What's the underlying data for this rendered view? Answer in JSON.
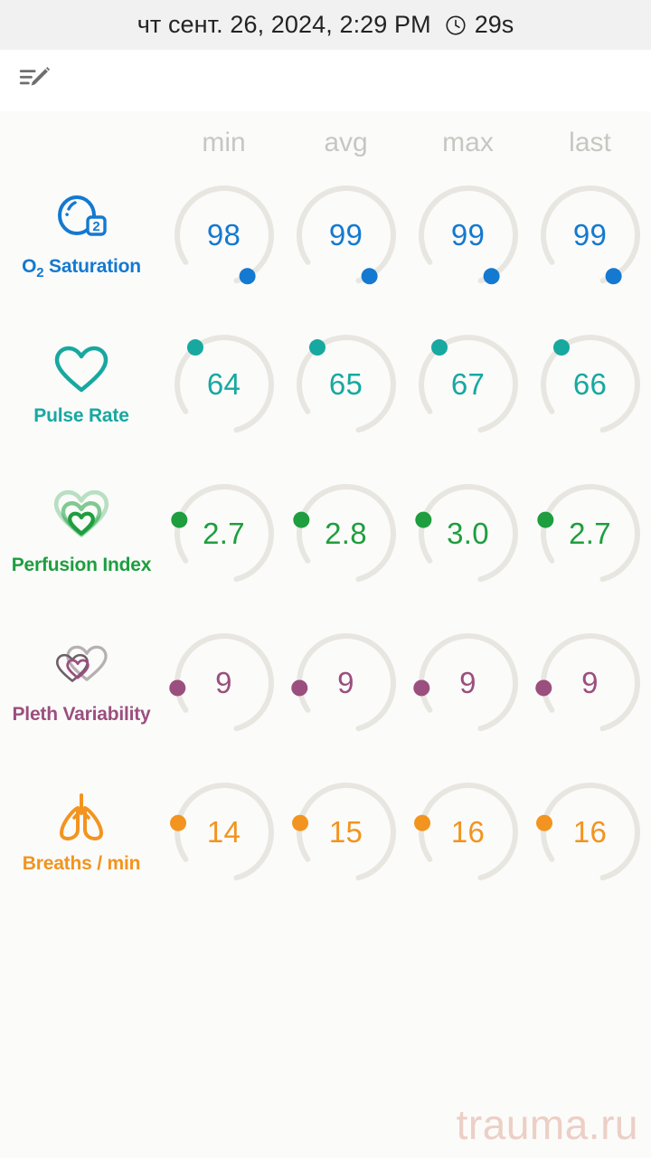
{
  "titlebar": {
    "datetime": "чт сент. 26, 2024, 2:29 PM",
    "clock_icon": "clock-icon",
    "elapsed": "29s"
  },
  "toolbar": {
    "edit_note_icon": "edit-note-icon"
  },
  "columns": [
    "min",
    "avg",
    "max",
    "last"
  ],
  "metrics": [
    {
      "name": "O₂ Saturation",
      "name_main": "O",
      "name_sub": "2",
      "name_rest": " Saturation",
      "icon": "oxygen-bubble-icon",
      "color": "#1479d0",
      "values": [
        "98",
        "99",
        "99",
        "99"
      ],
      "dot_positions": [
        0.95,
        0.95,
        0.95,
        0.95
      ]
    },
    {
      "name": "Pulse Rate",
      "icon": "heart-outline-icon",
      "color": "#17a8a0",
      "values": [
        "64",
        "65",
        "67",
        "66"
      ],
      "dot_positions": [
        0.3,
        0.3,
        0.3,
        0.3
      ]
    },
    {
      "name": "Perfusion Index",
      "icon": "nested-hearts-icon",
      "color": "#1e9e3e",
      "values": [
        "2.7",
        "2.8",
        "3.0",
        "2.7"
      ],
      "dot_positions": [
        0.18,
        0.18,
        0.18,
        0.18
      ]
    },
    {
      "name": "Pleth Variability",
      "icon": "overlapping-hearts-icon",
      "color": "#9b4f7e",
      "values": [
        "9",
        "9",
        "9",
        "9"
      ],
      "dot_positions": [
        0.1,
        0.1,
        0.1,
        0.1
      ]
    },
    {
      "name": "Breaths / min",
      "icon": "lungs-icon",
      "color": "#f2941f",
      "values": [
        "14",
        "15",
        "16",
        "16"
      ],
      "dot_positions": [
        0.16,
        0.16,
        0.16,
        0.16
      ]
    }
  ],
  "watermark": "trauma.ru",
  "colors": {
    "track": "#e8e6e0",
    "header_bg": "#f1f1f1",
    "content_bg": "#fbfbfa",
    "column_header": "#c7c7c2"
  }
}
